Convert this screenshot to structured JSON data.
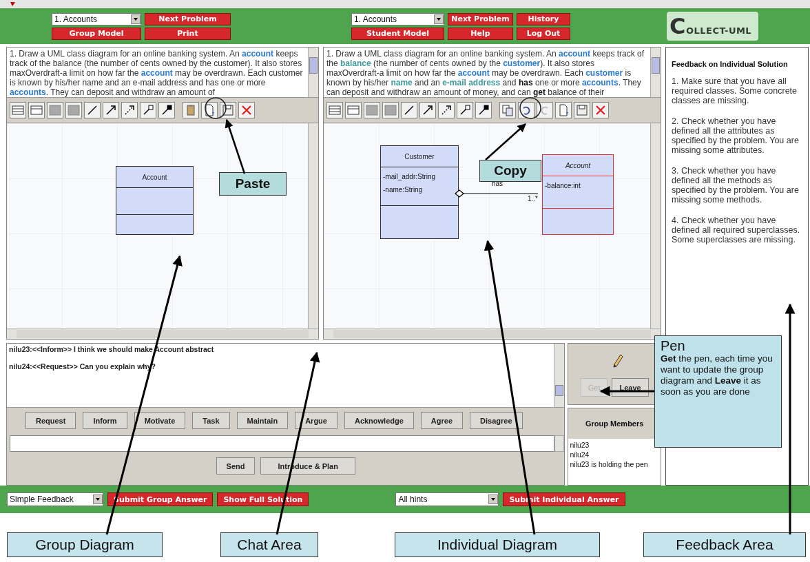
{
  "group_controls": {
    "problem_select": "1. Accounts",
    "next_button": "Next Problem",
    "model_button": "Group Model",
    "print_button": "Print"
  },
  "individual_controls": {
    "problem_select": "1. Accounts",
    "next_button": "Next Problem",
    "history_button": "History",
    "model_button": "Student Model",
    "help_button": "Help",
    "logout_button": "Log Out"
  },
  "logo": "COLLECT-UML",
  "group_diagram": {
    "problem_text": [
      {
        "text": "1. Draw a UML class diagram for an online banking system. An ",
        "kind": "plain"
      },
      {
        "text": "account",
        "kind": "concept"
      },
      {
        "text": " keeps track of the balance (the number of cents owned by the customer). It also stores maxOverdraft-a limit on how far the ",
        "kind": "plain"
      },
      {
        "text": "account",
        "kind": "concept"
      },
      {
        "text": " may be overdrawn. Each customer is known by his/her name and an e-mail address and has one or more ",
        "kind": "plain"
      },
      {
        "text": "accounts",
        "kind": "concept"
      },
      {
        "text": ". They can deposit and withdraw an amount of",
        "kind": "plain"
      }
    ],
    "classes": [
      {
        "name": "Account",
        "abstract": false,
        "highlighted": false
      }
    ]
  },
  "individual_diagram": {
    "problem_text": [
      {
        "text": "1. Draw a UML class diagram for an online banking system. An ",
        "kind": "plain"
      },
      {
        "text": "account",
        "kind": "concept"
      },
      {
        "text": " keeps track of the ",
        "kind": "plain"
      },
      {
        "text": "balance",
        "kind": "attribute"
      },
      {
        "text": " (the number of cents owned by the ",
        "kind": "plain"
      },
      {
        "text": "customer",
        "kind": "concept"
      },
      {
        "text": "). It also stores maxOverdraft-a limit on how far the ",
        "kind": "plain"
      },
      {
        "text": "account",
        "kind": "concept"
      },
      {
        "text": " may be overdrawn. Each ",
        "kind": "plain"
      },
      {
        "text": "customer",
        "kind": "concept"
      },
      {
        "text": " is known by his/her ",
        "kind": "plain"
      },
      {
        "text": "name",
        "kind": "attribute"
      },
      {
        "text": " and an ",
        "kind": "plain"
      },
      {
        "text": "e-mail address",
        "kind": "attribute"
      },
      {
        "text": " and ",
        "kind": "plain"
      },
      {
        "text": "has",
        "kind": "relation"
      },
      {
        "text": " one or more ",
        "kind": "plain"
      },
      {
        "text": "accounts",
        "kind": "concept"
      },
      {
        "text": ". They can deposit and withdraw an amount of money, and can ",
        "kind": "plain"
      },
      {
        "text": "get",
        "kind": "relation"
      },
      {
        "text": " balance of their",
        "kind": "plain"
      }
    ],
    "classes": [
      {
        "name": "Customer",
        "abstract": false,
        "highlighted": false,
        "attributes": [
          "-mail_addr:String",
          "-name:String"
        ]
      },
      {
        "name": "Account",
        "abstract": true,
        "highlighted": true,
        "attributes": [
          "-balance:int"
        ]
      }
    ],
    "association": {
      "label": "has",
      "multiplicity": "1..*"
    }
  },
  "feedback": {
    "title": "Feedback on Individual Solution",
    "items": [
      "1. Make sure that you have all required classes. Some concrete classes are missing.",
      "2. Check whether you have defined all the attributes as specified by the problem. You are missing some attributes.",
      "3. Check whether you have defined all the methods as specified by the problem. You are missing some methods.",
      "4. Check whether you have defined all required superclasses. Some superclasses are missing."
    ]
  },
  "chat": {
    "messages": [
      "nilu23:<<Inform>> I think we should make Account abstract",
      "nilu24:<<Request>> Can you explain why?"
    ],
    "sentence_openers": [
      "Request",
      "Inform",
      "Motivate",
      "Task",
      "Maintain",
      "Argue",
      "Acknowledge",
      "Agree",
      "Disagree"
    ],
    "send_button": "Send",
    "plan_button": "Introduce & Plan"
  },
  "pen": {
    "get_button": {
      "label": "Get",
      "disabled": true
    },
    "leave_button": {
      "label": "Leave",
      "disabled": false
    }
  },
  "group_members": {
    "title": "Group Members",
    "lines": [
      "nilu23",
      "nilu24",
      "nilu23 is holding the pen"
    ]
  },
  "bottom_bar": {
    "feedback_select": "Simple Feedback",
    "group_submit": "Submit Group Answer",
    "full_solution": "Show Full Solution",
    "hints_select": "All hints",
    "individual_submit": "Submit Individual Answer"
  },
  "annotations": {
    "paste": "Paste",
    "copy": "Copy",
    "pen_title": "Pen",
    "pen_text": "**Get** the pen, each time you want to update the group diagram and **Leave** it as soon as you are done"
  },
  "area_labels": [
    "Group Diagram",
    "Chat Area",
    "Individual Diagram",
    "Feedback Area"
  ]
}
